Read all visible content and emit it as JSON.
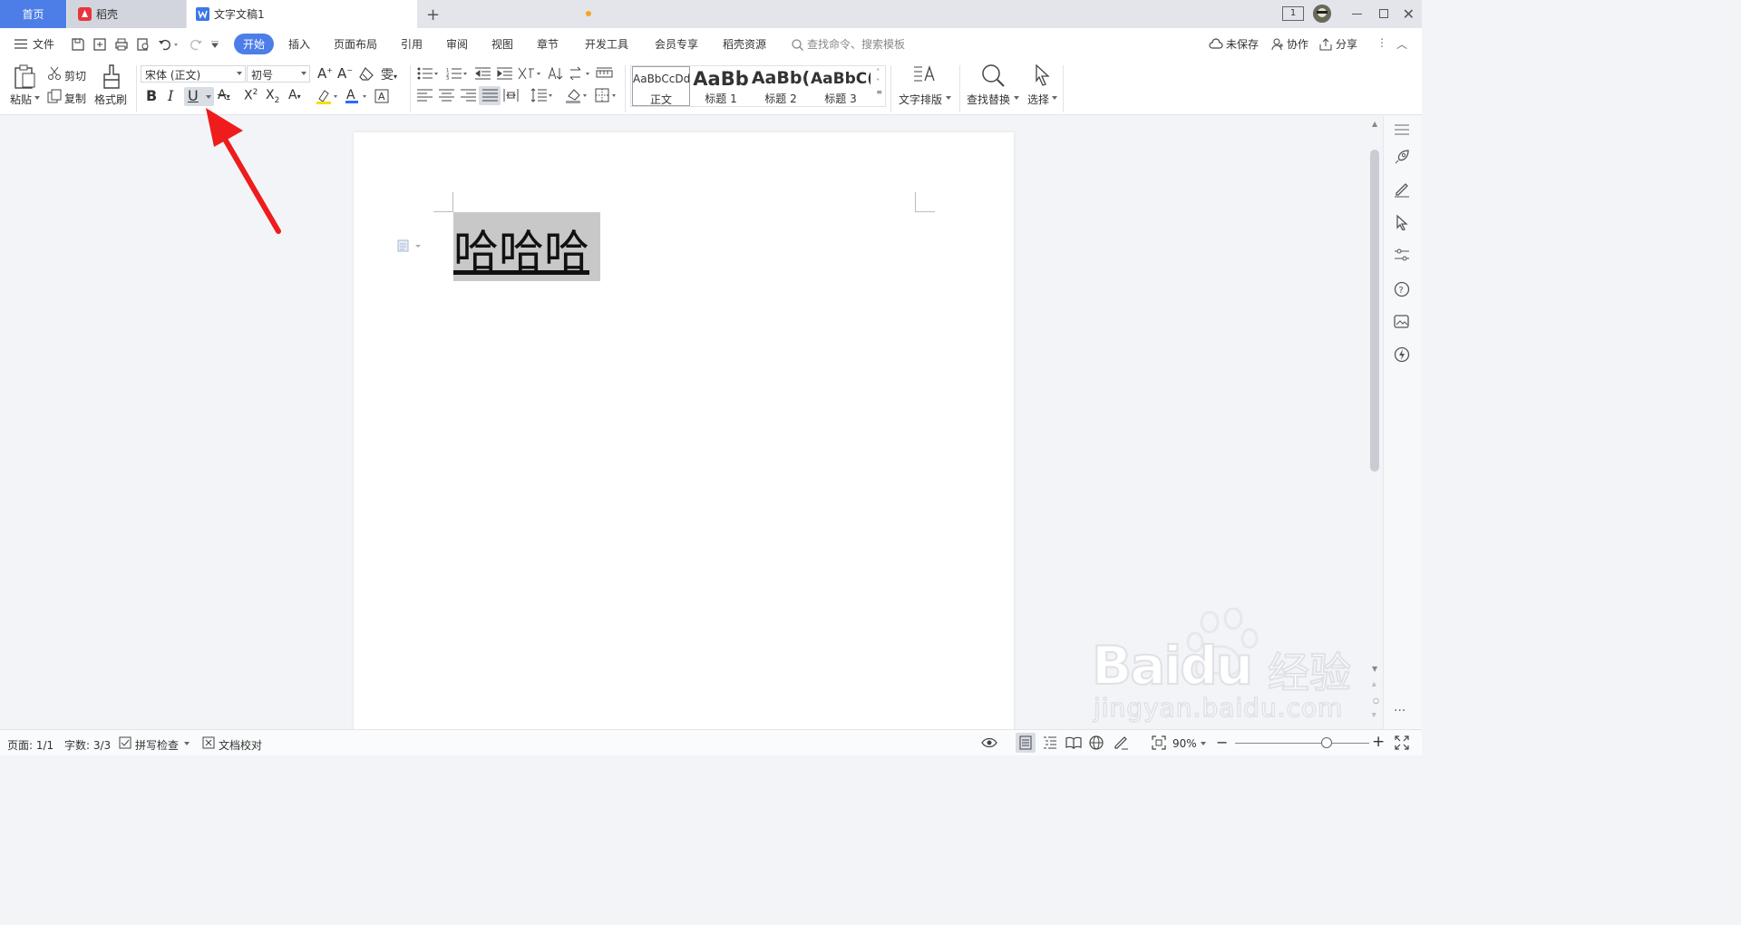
{
  "tabs": {
    "home": "首页",
    "daoke": "稻壳",
    "document": "文字文稿1",
    "daoke_color": "#e8363a",
    "doc_icon_color": "#3b78e7",
    "unsaved_dot_color": "#f5a623"
  },
  "titlebar": {
    "window_count": "1"
  },
  "menu": {
    "file": "文件",
    "tabs": [
      "开始",
      "插入",
      "页面布局",
      "引用",
      "审阅",
      "视图",
      "章节",
      "开发工具",
      "会员专享",
      "稻壳资源"
    ],
    "active_tab": "开始",
    "search_placeholder": "查找命令、搜索模板",
    "unsaved": "未保存",
    "collab": "协作",
    "share": "分享"
  },
  "toolbar": {
    "paste": "粘贴",
    "cut": "剪切",
    "copy": "复制",
    "format_painter": "格式刷",
    "font_name": "宋体 (正文)",
    "font_size": "初号",
    "styles": [
      {
        "preview": "AaBbCcDd",
        "name": "正文"
      },
      {
        "preview": "AaBb",
        "name": "标题 1"
      },
      {
        "preview": "AaBb(",
        "name": "标题 2"
      },
      {
        "preview": "AaBbC(",
        "name": "标题 3"
      }
    ],
    "text_layout": "文字排版",
    "find_replace": "查找替换",
    "select": "选择",
    "accent": "#4d7ee8"
  },
  "document": {
    "text": "哈哈哈"
  },
  "statusbar": {
    "page": "页面: 1/1",
    "word_count": "字数: 3/3",
    "spell_check": "拼写检查",
    "proofread": "文档校对",
    "zoom": "90%",
    "zoom_fraction": 0.68
  },
  "annotation": {
    "arrow_color": "#ee1c1c"
  },
  "watermark": {
    "brand": "Baidu",
    "brand_cn": "经验",
    "url": "jingyan.baidu.com"
  }
}
